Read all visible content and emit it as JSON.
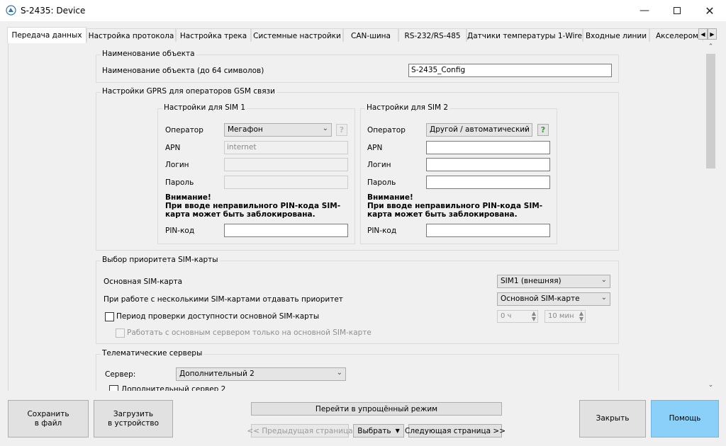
{
  "window": {
    "title": "S-2435: Device"
  },
  "tabs": [
    {
      "label": "Передача данных",
      "active": true
    },
    {
      "label": "Настройка протокола"
    },
    {
      "label": "Настройка трека"
    },
    {
      "label": "Системные настройки"
    },
    {
      "label": "CAN-шина"
    },
    {
      "label": "RS-232/RS-485"
    },
    {
      "label": "Датчики температуры 1-Wire"
    },
    {
      "label": "Входные линии"
    },
    {
      "label": "Акселероме"
    }
  ],
  "object_name": {
    "group_title": "Наименование объекта",
    "label": "Наименование объекта (до 64 символов)",
    "value": "S-2435_Config"
  },
  "gprs": {
    "group_title": "Настройки GPRS для операторов GSM связи",
    "sim1": {
      "title": "Настройки для SIM 1",
      "operator_label": "Оператор",
      "operator_value": "Мегафон",
      "apn_label": "APN",
      "apn_value": "internet",
      "login_label": "Логин",
      "login_value": "",
      "password_label": "Пароль",
      "password_value": "",
      "warning_title": "Внимание!",
      "warning_line1": "При вводе неправильного PIN-кода SIM-",
      "warning_line2": "карта может быть заблокирована.",
      "pin_label": "PIN-код",
      "pin_value": "",
      "help_glyph": "?"
    },
    "sim2": {
      "title": "Настройки для SIM 2",
      "operator_label": "Оператор",
      "operator_value": "Другой / автоматический",
      "apn_label": "APN",
      "apn_value": "",
      "login_label": "Логин",
      "login_value": "",
      "password_label": "Пароль",
      "password_value": "",
      "warning_title": "Внимание!",
      "warning_line1": "При вводе неправильного PIN-кода SIM-",
      "warning_line2": "карта может быть заблокирована.",
      "pin_label": "PIN-код",
      "pin_value": "",
      "help_glyph": "?"
    }
  },
  "sim_priority": {
    "group_title": "Выбор приоритета SIM-карты",
    "main_label": "Основная SIM-карта",
    "main_value": "SIM1 (внешняя)",
    "priority_label": "При работе с несколькими SIM-картами отдавать приоритет",
    "priority_value": "Основной SIM-карте",
    "check_period_label": "Период проверки доступности основной SIM-карты",
    "check_period_checked": false,
    "hours_value": "0 ч",
    "minutes_value": "10 мин",
    "main_server_only_label": "Работать с основным сервером только на основной SIM-карте",
    "main_server_only_checked": false
  },
  "telematics": {
    "group_title": "Телематические серверы",
    "server_label": "Сервер:",
    "server_value": "Дополнительный 2",
    "extra_server_label": "Дополнительный сервер 2",
    "extra_server_checked": false
  },
  "footer": {
    "save_line1": "Сохранить",
    "save_line2": "в файл",
    "load_line1": "Загрузить",
    "load_line2": "в устройство",
    "simple_mode": "Перейти в упрощённый режим",
    "prev_page": "<< Предыдущая страница",
    "select": "Выбрать",
    "next_page": "Следующая страница >>",
    "close": "Закрыть",
    "help": "Помощь"
  },
  "colors": {
    "help_button": "#8ad0f8",
    "help_green": "#3a9a3a"
  }
}
